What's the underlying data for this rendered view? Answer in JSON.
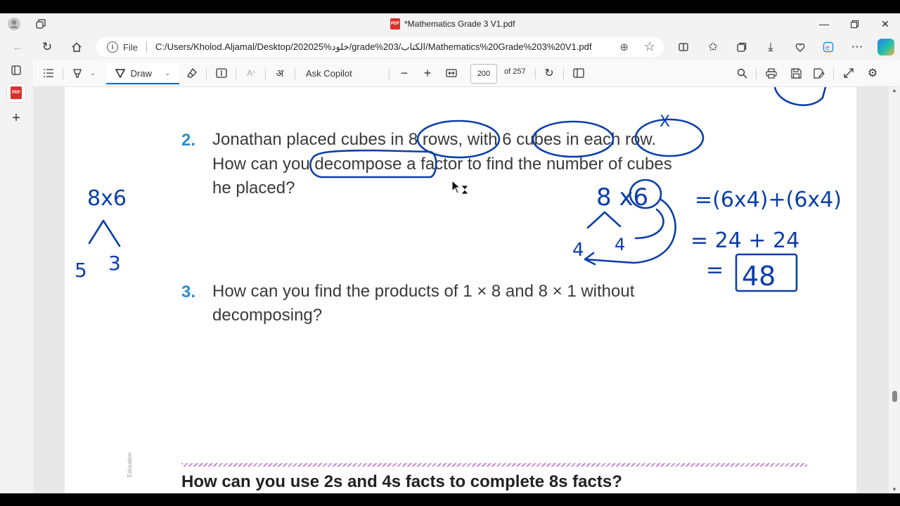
{
  "browser": {
    "tab_title": "*Mathematics Grade 3 V1.pdf",
    "address_scheme_label": "File",
    "url": "C:/Users/Kholod.Aljamal/Desktop/202025%خلود/grade%203/الكتاب/Mathematics%20Grade%203%20V1.pdf"
  },
  "pdf_toolbar": {
    "draw_label": "Draw",
    "ask_copilot_label": "Ask Copilot",
    "page_current": "200",
    "page_total_label": "of 257"
  },
  "page": {
    "q2": {
      "number": "2.",
      "line1": "Jonathan placed cubes in 8 rows, with 6 cubes in each row.",
      "line2": "How can you decompose a factor to find the number of cubes",
      "line3": "he placed?"
    },
    "q3": {
      "number": "3.",
      "line1": "How can you find the products of 1 × 8 and 8 × 1 without",
      "line2": "decomposing?"
    },
    "heading": "How can you use 2s and 4s facts to complete 8s facts?",
    "vertical_credit": "Education"
  },
  "annotations": {
    "left_expr": "8x6",
    "left_split_a": "5",
    "left_split_b": "3",
    "right_expr": "8 x6",
    "split_left": "4",
    "split_right": "4",
    "eq1": "=(6x4)+(6x4)",
    "eq2": "= 24 + 24",
    "eq3": "=",
    "answer": "48",
    "mark_x": "X"
  },
  "colors": {
    "ink": "#0b3fa8",
    "question_number": "#2a8ec9",
    "accent": "#0f6cbd"
  }
}
